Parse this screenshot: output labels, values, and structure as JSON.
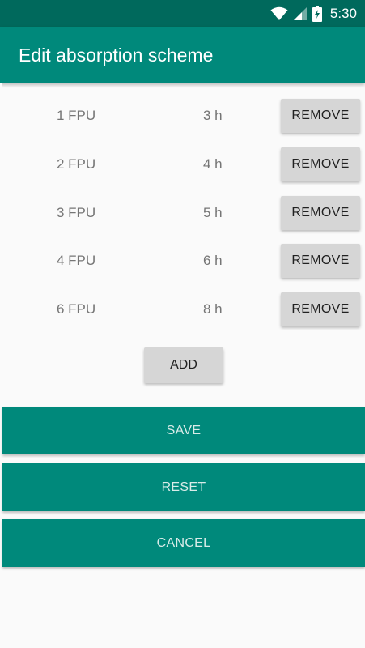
{
  "status_bar": {
    "time": "5:30",
    "icons": [
      "wifi-icon",
      "signal-icon",
      "battery-icon"
    ]
  },
  "app_bar": {
    "title": "Edit absorption scheme"
  },
  "scheme_rows": [
    {
      "fpu": "1 FPU",
      "hours": "3 h",
      "remove_label": "REMOVE"
    },
    {
      "fpu": "2 FPU",
      "hours": "4 h",
      "remove_label": "REMOVE"
    },
    {
      "fpu": "3 FPU",
      "hours": "5 h",
      "remove_label": "REMOVE"
    },
    {
      "fpu": "4 FPU",
      "hours": "6 h",
      "remove_label": "REMOVE"
    },
    {
      "fpu": "6 FPU",
      "hours": "8 h",
      "remove_label": "REMOVE"
    }
  ],
  "actions": {
    "add_label": "ADD",
    "save_label": "SAVE",
    "reset_label": "RESET",
    "cancel_label": "CANCEL"
  },
  "colors": {
    "status_bar": "#00695c",
    "primary": "#00897b",
    "button_grey": "#d6d6d6",
    "background": "#fafafa"
  }
}
